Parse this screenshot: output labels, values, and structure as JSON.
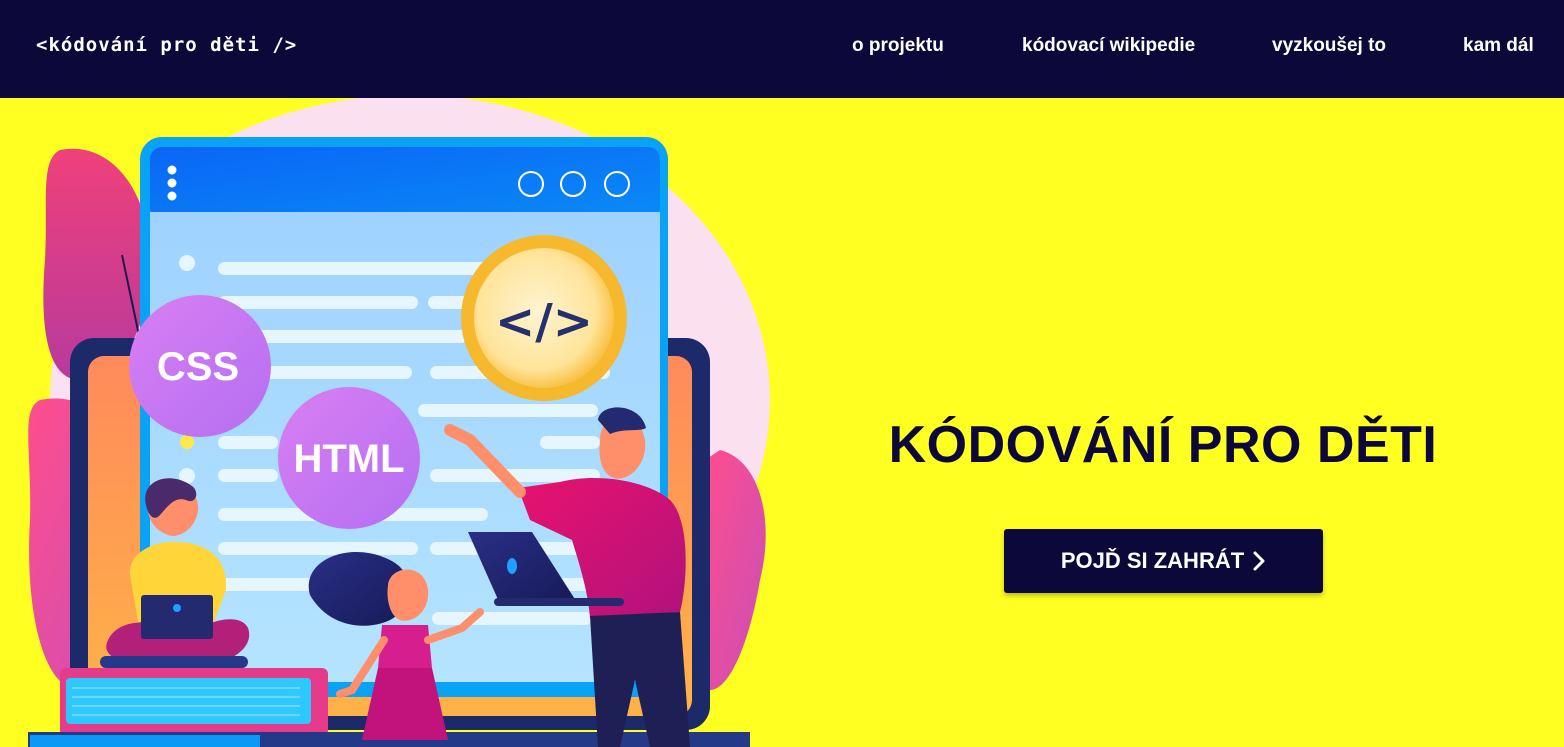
{
  "header": {
    "brand": "<kódování pro děti />",
    "nav": [
      {
        "label": "o projektu"
      },
      {
        "label": "kódovací wikipedie"
      },
      {
        "label": "vyzkoušej to"
      },
      {
        "label": "kam dál"
      }
    ]
  },
  "illustration": {
    "badge_css": "CSS",
    "badge_html": "HTML",
    "badge_code": "</>"
  },
  "hero": {
    "title": "KÓDOVÁNÍ PRO DĚTI",
    "cta_label": "POJĎ SI ZAHRÁT",
    "cta_icon": "chevron-right-icon"
  },
  "colors": {
    "header_bg": "#0c0839",
    "page_bg": "#ffff22",
    "title": "#0c0839",
    "button_bg": "#0c0839",
    "button_text": "#ffffff"
  }
}
